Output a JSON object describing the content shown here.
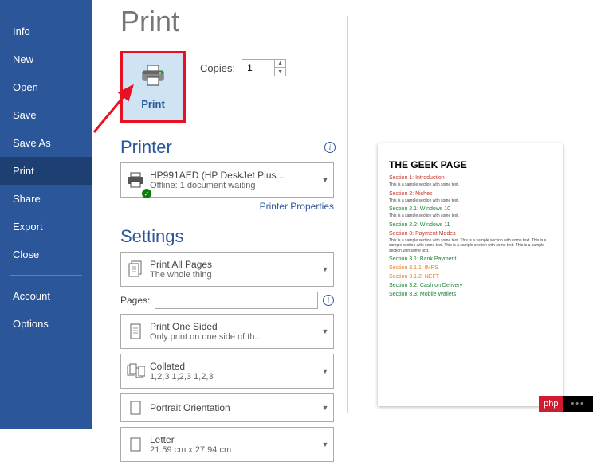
{
  "sidebar": {
    "items": [
      {
        "label": "Info"
      },
      {
        "label": "New"
      },
      {
        "label": "Open"
      },
      {
        "label": "Save"
      },
      {
        "label": "Save As"
      },
      {
        "label": "Print"
      },
      {
        "label": "Share"
      },
      {
        "label": "Export"
      },
      {
        "label": "Close"
      }
    ],
    "footer": [
      {
        "label": "Account"
      },
      {
        "label": "Options"
      }
    ]
  },
  "title": "Print",
  "printButton": "Print",
  "copies": {
    "label": "Copies:",
    "value": "1"
  },
  "printerHead": "Printer",
  "printer": {
    "name": "HP991AED (HP DeskJet Plus...",
    "status": "Offline: 1 document waiting",
    "propsLink": "Printer Properties"
  },
  "settingsHead": "Settings",
  "printAll": {
    "t1": "Print All Pages",
    "t2": "The whole thing"
  },
  "pages": {
    "label": "Pages:",
    "value": ""
  },
  "oneSided": {
    "t1": "Print One Sided",
    "t2": "Only print on one side of th..."
  },
  "collated": {
    "t1": "Collated",
    "t2": "1,2,3    1,2,3    1,2,3"
  },
  "orientation": {
    "t1": "Portrait Orientation",
    "t2": ""
  },
  "paper": {
    "t1": "Letter",
    "t2": "21.59 cm x 27.94 cm"
  },
  "preview": {
    "title": "THE GEEK PAGE",
    "s1": "Section 1: Introduction",
    "s1c": "#c0392b",
    "b1": "This is a sample section with some text.",
    "s2": "Section 2: Niches",
    "s2c": "#c0392b",
    "b2": "This is a sample section with some text.",
    "s21": "Section 2.1: Windows 10",
    "s21c": "#1e7e34",
    "b21": "This is a sample section with some text.",
    "s22": "Section 2.2: Windows 11",
    "s22c": "#1e7e34",
    "s3": "Section 3: Payment Modes",
    "s3c": "#c0392b",
    "b3": "This is a sample section with some text. This is a sample section with some text. This is a sample section with some text. This is a sample section with some text. This is a sample section with some text.",
    "s31": "Section 3.1: Bank Payment",
    "s31c": "#1e7e34",
    "s311": "Section 3.1.1: IMPS",
    "s311c": "#e67e22",
    "s312": "Section 3.1.2: NEFT",
    "s312c": "#e67e22",
    "s32": "Section 3.2: Cash on Delivery",
    "s32c": "#1e7e34",
    "s33": "Section 3.3: Mobile Wallets",
    "s33c": "#1e7e34"
  },
  "watermark": {
    "a": "php",
    "b": "•••"
  }
}
